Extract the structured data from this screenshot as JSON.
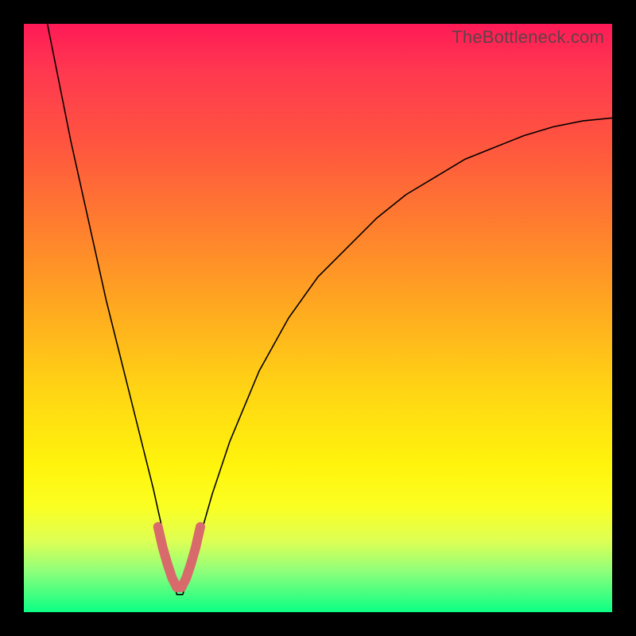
{
  "watermark": "TheBottleneck.com",
  "colors": {
    "curve": "#000000",
    "highlight": "#d86a6c",
    "gradient_top": "#ff1a56",
    "gradient_mid": "#ffd414",
    "gradient_bottom": "#0bff85",
    "frame": "#000000"
  },
  "chart_data": {
    "type": "line",
    "title": "",
    "xlabel": "",
    "ylabel": "",
    "xlim": [
      0,
      100
    ],
    "ylim": [
      0,
      100
    ],
    "note": "x and y are in percent of plot width/height; y=0 is bottom (green), y=100 is top (red). Curve is a V-shaped bottleneck profile with minimum near x≈26.",
    "series": [
      {
        "name": "bottleneck-curve",
        "x": [
          4,
          6,
          8,
          10,
          12,
          14,
          16,
          18,
          20,
          22,
          24,
          25,
          26,
          27,
          28,
          30,
          32,
          35,
          40,
          45,
          50,
          55,
          60,
          65,
          70,
          75,
          80,
          85,
          90,
          95,
          100
        ],
        "y": [
          100,
          90,
          80,
          71,
          62,
          53,
          45,
          37,
          29,
          21,
          12,
          7,
          3,
          3,
          6,
          13,
          20,
          29,
          41,
          50,
          57,
          62,
          67,
          71,
          74,
          77,
          79,
          81,
          82.5,
          83.5,
          84
        ]
      }
    ],
    "highlight": {
      "name": "trough-highlight",
      "x": [
        22.8,
        23.6,
        24.4,
        25.2,
        26,
        26.8,
        27.6,
        28.4,
        29.2,
        30
      ],
      "y": [
        14.5,
        11,
        8.2,
        5.8,
        4.2,
        4.2,
        5.8,
        8.2,
        11,
        14.5
      ]
    }
  }
}
